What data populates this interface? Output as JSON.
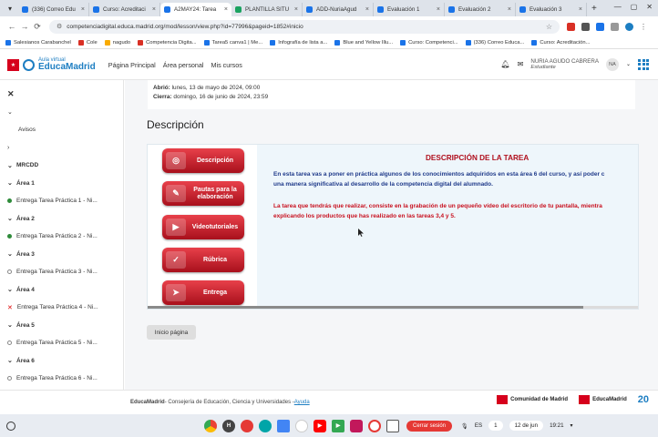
{
  "browser": {
    "tabs": [
      {
        "label": "(336) Correo Edu",
        "active": false
      },
      {
        "label": "Curso: Acreditaci",
        "active": false
      },
      {
        "label": "A2MAY24: Tarea",
        "active": true
      },
      {
        "label": "PLANTILLA SITU",
        "active": false
      },
      {
        "label": "ADD-NuriaAgud",
        "active": false
      },
      {
        "label": "Evaluación 1",
        "active": false
      },
      {
        "label": "Evaluación 2",
        "active": false
      },
      {
        "label": "Evaluación 3",
        "active": false
      }
    ],
    "url": "competenciadigital.educa.madrid.org/mod/lesson/view.php?id=77996&pageid=1852#inicio",
    "bookmarks": [
      "Salesianos Carabanchel",
      "Cole",
      "nagudo",
      "Competencia Digita...",
      "Tarea5 canva1 | Me...",
      "Infografía de lista a...",
      "Blue and Yellow Illu...",
      "Curso: Competenci...",
      "(336) Correo Educa...",
      "Curso: Acreditación..."
    ]
  },
  "header": {
    "logo_line1": "Aula virtual",
    "logo_line2": "EducaMadrid",
    "nav": [
      "Página Principal",
      "Área personal",
      "Mis cursos"
    ],
    "user_name": "NURIA AGUDO CABRERA",
    "user_role": "Estudiante",
    "avatar_initials": "NA"
  },
  "sidebar": {
    "avisos": "Avisos",
    "course": "MRCDD",
    "areas": [
      {
        "title": "Área 1",
        "item": "Entrega Tarea Práctica 1 - Ni...",
        "status": "done"
      },
      {
        "title": "Área 2",
        "item": "Entrega Tarea Práctica 2 - Ni...",
        "status": "done"
      },
      {
        "title": "Área 3",
        "item": "Entrega Tarea Práctica 3 - Ni...",
        "status": "open"
      },
      {
        "title": "Área 4",
        "item": "Entrega Tarea Práctica 4 - Ni...",
        "status": "fail"
      },
      {
        "title": "Área 5",
        "item": "Entrega Tarea Práctica 5 - Ni...",
        "status": "open"
      },
      {
        "title": "Área 6",
        "item": "Entrega Tarea Práctica 6 - Ni...",
        "status": "open"
      }
    ]
  },
  "main": {
    "opened_label": "Abrió:",
    "opened_value": "lunes, 13 de mayo de 2024, 09:00",
    "closes_label": "Cierra:",
    "closes_value": "domingo, 16 de junio de 2024, 23:59",
    "section_title": "Descripción",
    "menu_buttons": [
      {
        "label": "Descripción",
        "icon": "target-icon"
      },
      {
        "label": "Pautas para la elaboración",
        "icon": "pen-icon"
      },
      {
        "label": "Videotutoriales",
        "icon": "video-icon"
      },
      {
        "label": "Rúbrica",
        "icon": "clipboard-icon"
      },
      {
        "label": "Entrega",
        "icon": "send-icon"
      }
    ],
    "task_title": "DESCRIPCIÓN DE LA TAREA",
    "task_p1_line1": "En esta tarea vas a poner en práctica algunos de los conocimientos adquiridos en esta área 6 del curso, y así poder c",
    "task_p1_line2": "una manera significativa al desarrollo de la competencia digital del alumnado.",
    "task_p2_line1": "La tarea que tendrás que realizar, consiste en la grabación de un pequeño vídeo del escritorio de tu pantalla, mientra",
    "task_p2_line2": "explicando los productos que has realizado en las tareas 3,4 y 5.",
    "inicio_button": "Inicio página"
  },
  "footer": {
    "brand": "EducaMadrid",
    "text": " - Consejería de Educación, Ciencia y Universidades - ",
    "link": "Ayuda",
    "logo1": "Comunidad de Madrid",
    "logo2": "EducaMadrid",
    "logo3": "20"
  },
  "taskbar": {
    "cerrar": "Cerrar sesión",
    "lang": "ES",
    "notif": "1",
    "date": "12 de jun",
    "time": "19:21"
  }
}
